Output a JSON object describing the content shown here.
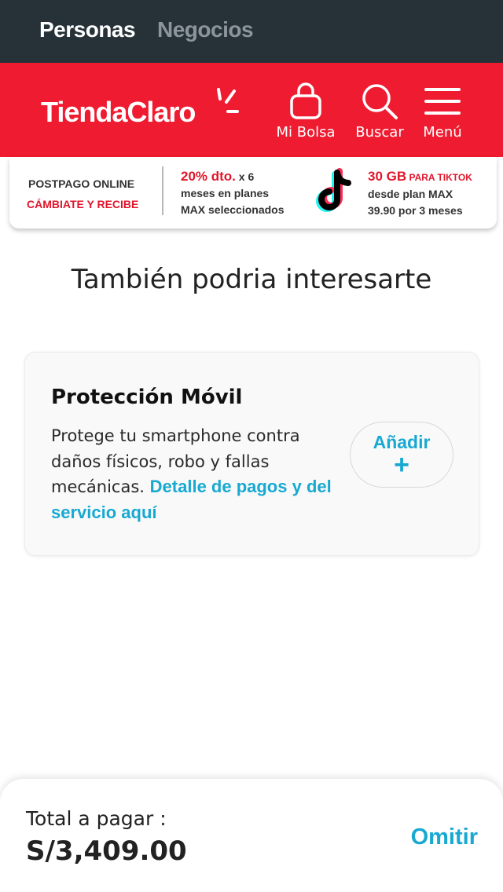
{
  "segments": {
    "active": "Personas",
    "inactive": "Negocios"
  },
  "header": {
    "logo_text": "TiendaClaro",
    "bag_label": "Mi Bolsa",
    "search_label": "Buscar",
    "menu_label": "Menú"
  },
  "promo": {
    "line1": "POSTPAGO ONLINE",
    "line2": "CÁMBIATE Y RECIBE",
    "offer1_highlight": "20% dto.",
    "offer1_rest": " x 6",
    "offer1_line2": "meses en planes",
    "offer1_line3": "MAX seleccionados",
    "offer2_highlight": "30 GB",
    "offer2_tag": " PARA TIKTOK",
    "offer2_line2": "desde plan MAX",
    "offer2_line3": "39.90 por 3 meses"
  },
  "section_title": "También podria interesarte",
  "card": {
    "title": "Protección Móvil",
    "description": "Protege tu smartphone contra daños físicos, robo y fallas mecánicas. ",
    "link_text": "Detalle de pagos y del servicio aquí",
    "add_label": "Añadir",
    "add_symbol": "+"
  },
  "footer": {
    "total_label": "Total a pagar :",
    "total_value": "S/3,409.00",
    "skip_label": "Omitir"
  },
  "colors": {
    "brand_red": "#ef1b30",
    "accent_blue": "#17a9d2",
    "topbar": "#263238"
  }
}
